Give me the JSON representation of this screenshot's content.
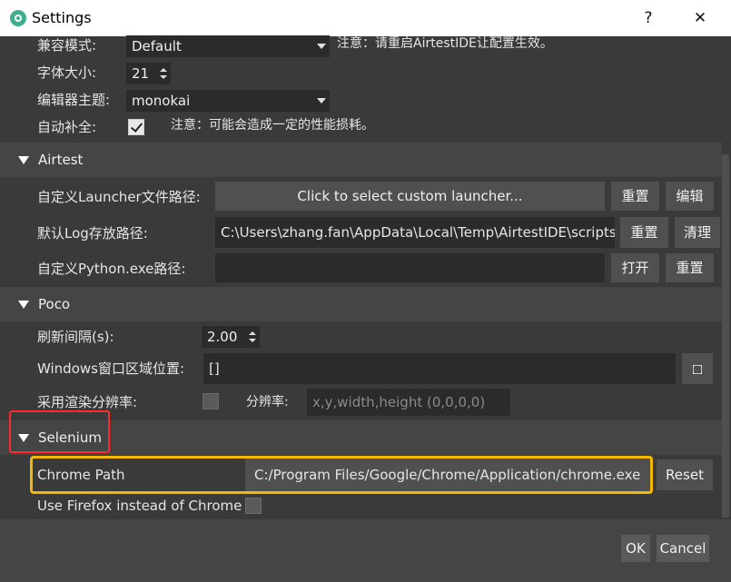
{
  "window": {
    "title": "Settings",
    "help_label": "?",
    "close_label": "✕"
  },
  "general": {
    "compat_mode_label": "兼容模式:",
    "compat_mode_value": "Default",
    "compat_mode_note": "注意：请重启AirtestIDE让配置生效。",
    "font_size_label": "字体大小:",
    "font_size_value": "21",
    "editor_theme_label": "编辑器主题:",
    "editor_theme_value": "monokai",
    "autocomplete_label": "自动补全:",
    "autocomplete_checked": true,
    "autocomplete_note": "注意：可能会造成一定的性能损耗。"
  },
  "airtest": {
    "section_title": "Airtest",
    "launcher_label": "自定义Launcher文件路径:",
    "launcher_button": "Click to select custom launcher...",
    "launcher_reset": "重置",
    "launcher_edit": "编辑",
    "log_label": "默认Log存放路径:",
    "log_value": "C:\\Users\\zhang.fan\\AppData\\Local\\Temp\\AirtestIDE\\scripts",
    "log_reset": "重置",
    "log_clear": "清理",
    "python_label": "自定义Python.exe路径:",
    "python_value": "",
    "python_open": "打开",
    "python_reset": "重置"
  },
  "poco": {
    "section_title": "Poco",
    "refresh_label": "刷新间隔(s):",
    "refresh_value": "2.00",
    "region_label": "Windows窗口区域位置:",
    "region_value": "[]",
    "resolution_label": "采用渲染分辨率:",
    "resolution_checked": false,
    "resolution_sub_label": "分辨率:",
    "resolution_placeholder": "x,y,width,height (0,0,0,0)"
  },
  "selenium": {
    "section_title": "Selenium",
    "chrome_path_label": "Chrome Path",
    "chrome_path_value": "C:/Program Files/Google/Chrome/Application/chrome.exe",
    "chrome_path_reset": "Reset",
    "firefox_label": "Use Firefox instead of Chrome",
    "firefox_checked": false
  },
  "footer": {
    "ok_label": "OK",
    "cancel_label": "Cancel"
  },
  "colors": {
    "highlight_red": "#ff2a2a",
    "highlight_yellow": "#f5b800",
    "panel_bg": "#3a3a3a",
    "section_bg": "#454545"
  },
  "icons": {
    "app": "settings-gear-icon",
    "section_toggle": "triangle-down-icon",
    "region_picker": "expand-corners-icon"
  }
}
